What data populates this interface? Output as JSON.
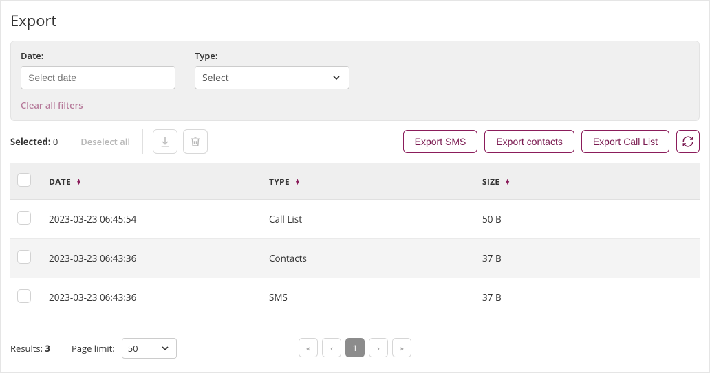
{
  "title": "Export",
  "filters": {
    "date_label": "Date:",
    "date_placeholder": "Select date",
    "type_label": "Type:",
    "type_selected": "Select",
    "clear_label": "Clear all filters"
  },
  "actions": {
    "selected_label": "Selected:",
    "selected_count": "0",
    "deselect_label": "Deselect all",
    "export_sms": "Export SMS",
    "export_contacts": "Export contacts",
    "export_calllist": "Export Call List"
  },
  "table": {
    "headers": {
      "date": "DATE",
      "type": "TYPE",
      "size": "SIZE"
    },
    "rows": [
      {
        "date": "2023-03-23 06:45:54",
        "type": "Call List",
        "size": "50 B"
      },
      {
        "date": "2023-03-23 06:43:36",
        "type": "Contacts",
        "size": "37 B"
      },
      {
        "date": "2023-03-23 06:43:36",
        "type": "SMS",
        "size": "37 B"
      }
    ]
  },
  "footer": {
    "results_label": "Results:",
    "results_count": "3",
    "page_limit_label": "Page limit:",
    "page_limit_value": "50",
    "current_page": "1"
  }
}
